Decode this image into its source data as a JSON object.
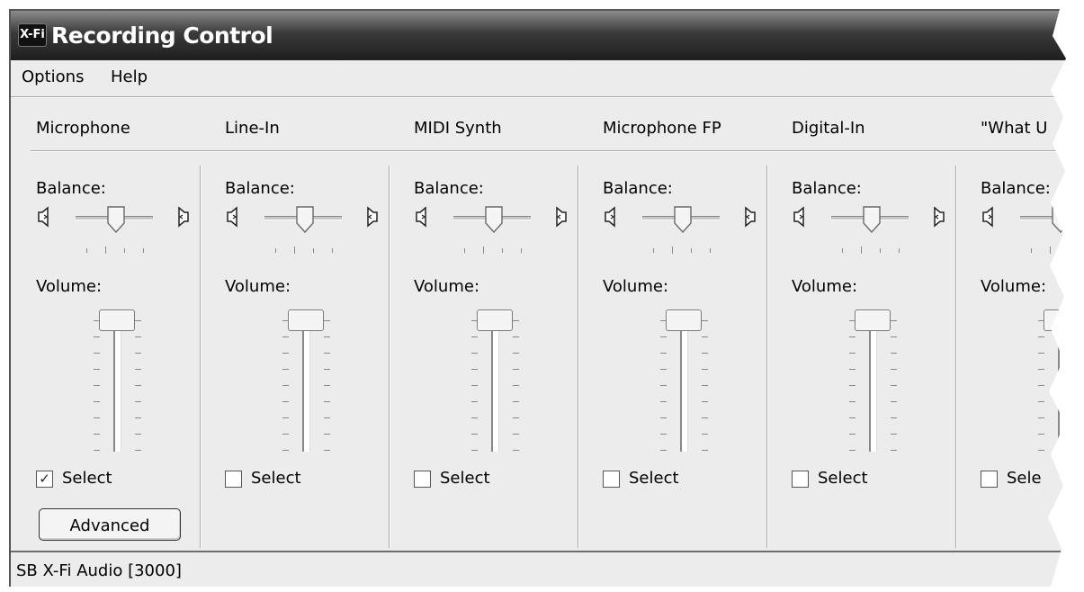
{
  "window": {
    "title": "Recording Control",
    "icon": "X-Fi"
  },
  "menu": [
    {
      "label": "Options"
    },
    {
      "label": "Help"
    }
  ],
  "channels": [
    {
      "name": "Microphone",
      "balance_label": "Balance:",
      "volume_label": "Volume:",
      "select_label": "Select",
      "selected": true,
      "advanced_label": "Advanced"
    },
    {
      "name": "Line-In",
      "balance_label": "Balance:",
      "volume_label": "Volume:",
      "select_label": "Select",
      "selected": false
    },
    {
      "name": "MIDI Synth",
      "balance_label": "Balance:",
      "volume_label": "Volume:",
      "select_label": "Select",
      "selected": false
    },
    {
      "name": "Microphone FP",
      "balance_label": "Balance:",
      "volume_label": "Volume:",
      "select_label": "Select",
      "selected": false
    },
    {
      "name": "Digital-In",
      "balance_label": "Balance:",
      "volume_label": "Volume:",
      "select_label": "Select",
      "selected": false
    },
    {
      "name": "\"What U",
      "balance_label": "Balance:",
      "volume_label": "Volume:",
      "select_label": "Sele",
      "selected": false
    }
  ],
  "status": {
    "text": "SB X-Fi Audio [3000]"
  }
}
